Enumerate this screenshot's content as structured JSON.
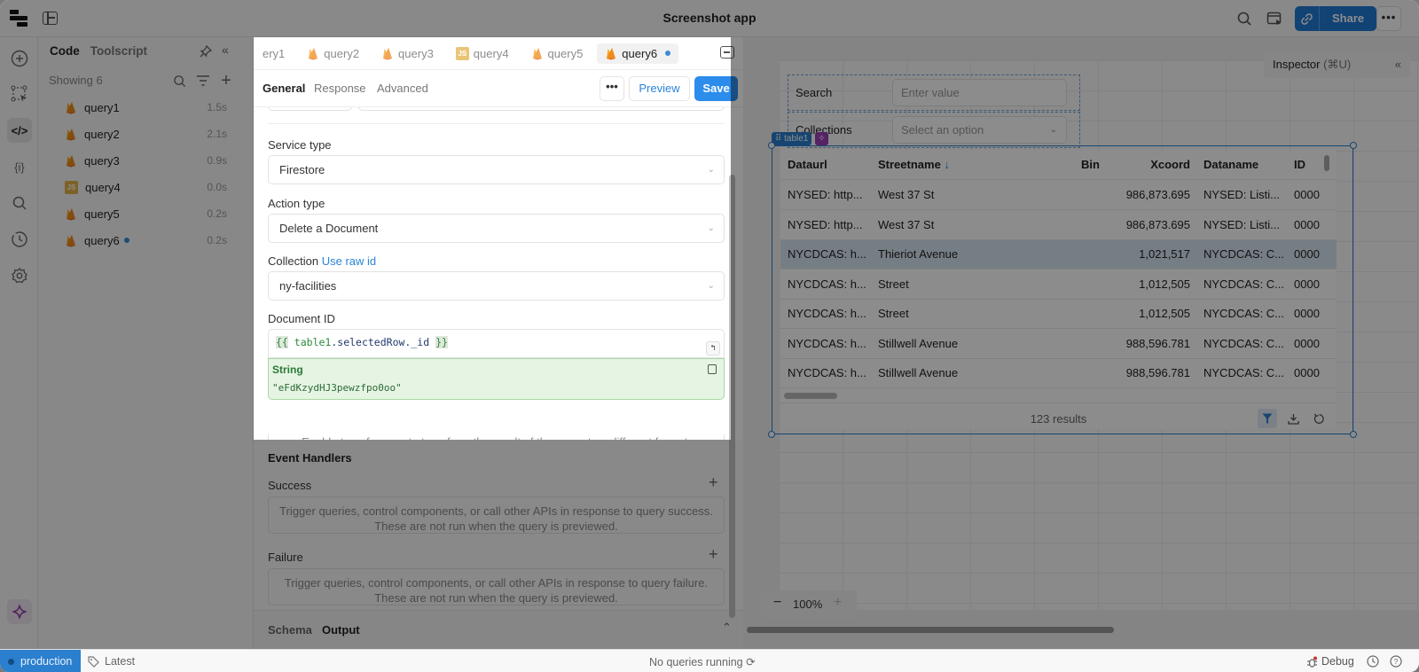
{
  "header": {
    "title": "Screenshot app",
    "share_label": "Share",
    "more_label": "•••"
  },
  "rail": {
    "items": [
      {
        "icon": "plus-circle-icon"
      },
      {
        "icon": "select-component-icon"
      },
      {
        "icon": "code-icon",
        "label": "</>",
        "active": true
      },
      {
        "icon": "state-icon",
        "label": "{i}"
      },
      {
        "icon": "search-icon"
      },
      {
        "icon": "history-icon"
      },
      {
        "icon": "settings-icon"
      },
      {
        "icon": "assist-sparkle-icon"
      }
    ]
  },
  "code_panel": {
    "tabs": [
      "Code",
      "Toolscript"
    ],
    "showing": "Showing 6",
    "queries": [
      {
        "name": "query1",
        "time": "1.5s",
        "type": "firestore"
      },
      {
        "name": "query2",
        "time": "2.1s",
        "type": "firestore"
      },
      {
        "name": "query3",
        "time": "0.9s",
        "type": "firestore"
      },
      {
        "name": "query4",
        "time": "0.0s",
        "type": "js"
      },
      {
        "name": "query5",
        "time": "0.2s",
        "type": "firestore"
      },
      {
        "name": "query6",
        "time": "0.2s",
        "type": "firestore",
        "unsaved": true
      }
    ]
  },
  "editor": {
    "tabs": [
      {
        "name": "ery1",
        "type": "none"
      },
      {
        "name": "query2",
        "type": "firestore"
      },
      {
        "name": "query3",
        "type": "firestore"
      },
      {
        "name": "query4",
        "type": "js"
      },
      {
        "name": "query5",
        "type": "firestore"
      },
      {
        "name": "query6",
        "type": "firestore",
        "active": true,
        "unsaved": true
      }
    ],
    "subtabs": [
      "General",
      "Response",
      "Advanced"
    ],
    "more_label": "•••",
    "preview_label": "Preview",
    "save_label": "Save",
    "service_type": {
      "label": "Service type",
      "value": "Firestore"
    },
    "action_type": {
      "label": "Action type",
      "value": "Delete a Document"
    },
    "collection": {
      "label": "Collection",
      "link": "Use raw id",
      "value": "ny-facilities"
    },
    "document_id": {
      "label": "Document ID",
      "open": "{{",
      "ident": "table1",
      "prop": ".selectedRow._id",
      "close": "}}",
      "eval_type": "String",
      "eval_value": "\"eFdKzydHJ3pewzfpo0oo\""
    },
    "transformer_hint": "Enable transformers to transform the result of the query to a different format.",
    "event_handlers": {
      "title": "Event Handlers",
      "success_label": "Success",
      "success_hint_1": "Trigger queries, control components, or call other APIs in response to query success.",
      "success_hint_2": "These are not run when the query is previewed.",
      "failure_label": "Failure",
      "failure_hint_1": "Trigger queries, control components, or call other APIs in response to query failure.",
      "failure_hint_2": "These are not run when the query is previewed."
    },
    "bottom_tabs": [
      "Schema",
      "Output"
    ]
  },
  "canvas": {
    "inspector_label": "Inspector",
    "inspector_shortcut": "(⌘U)",
    "search_label": "Search",
    "search_placeholder": "Enter value",
    "collections_label": "Collections",
    "collections_placeholder": "Select an option",
    "table_badge": "table1",
    "table": {
      "columns": [
        "Dataurl",
        "Streetname",
        "Bin",
        "Xcoord",
        "Dataname",
        "ID"
      ],
      "sort_indicator": "↓",
      "rows": [
        [
          "NYSED: http...",
          "West 37 St",
          "",
          "986,873.695",
          "NYSED: Listi...",
          "0000"
        ],
        [
          "NYSED: http...",
          "West 37 St",
          "",
          "986,873.695",
          "NYSED: Listi...",
          "0000"
        ],
        [
          "NYCDCAS: h...",
          "Thieriot Avenue",
          "",
          "1,021,517",
          "NYCDCAS: C...",
          "0000"
        ],
        [
          "NYCDCAS: h...",
          "Street",
          "",
          "1,012,505",
          "NYCDCAS: C...",
          "0000"
        ],
        [
          "NYCDCAS: h...",
          "Street",
          "",
          "1,012,505",
          "NYCDCAS: C...",
          "0000"
        ],
        [
          "NYCDCAS: h...",
          "Stillwell Avenue",
          "",
          "988,596.781",
          "NYCDCAS: C...",
          "0000"
        ],
        [
          "NYCDCAS: h...",
          "Stillwell Avenue",
          "",
          "988,596.781",
          "NYCDCAS: C...",
          "0000"
        ]
      ],
      "selected_row": 2,
      "results": "123 results"
    },
    "zoom_level": "100%"
  },
  "statusbar": {
    "environment": "production",
    "version": "Latest",
    "queries_status": "No queries running",
    "debug_label": "Debug"
  },
  "colors": {
    "accent": "#2b8cec",
    "selection": "#2a7fce",
    "eval_bg": "#e6f4e4"
  }
}
